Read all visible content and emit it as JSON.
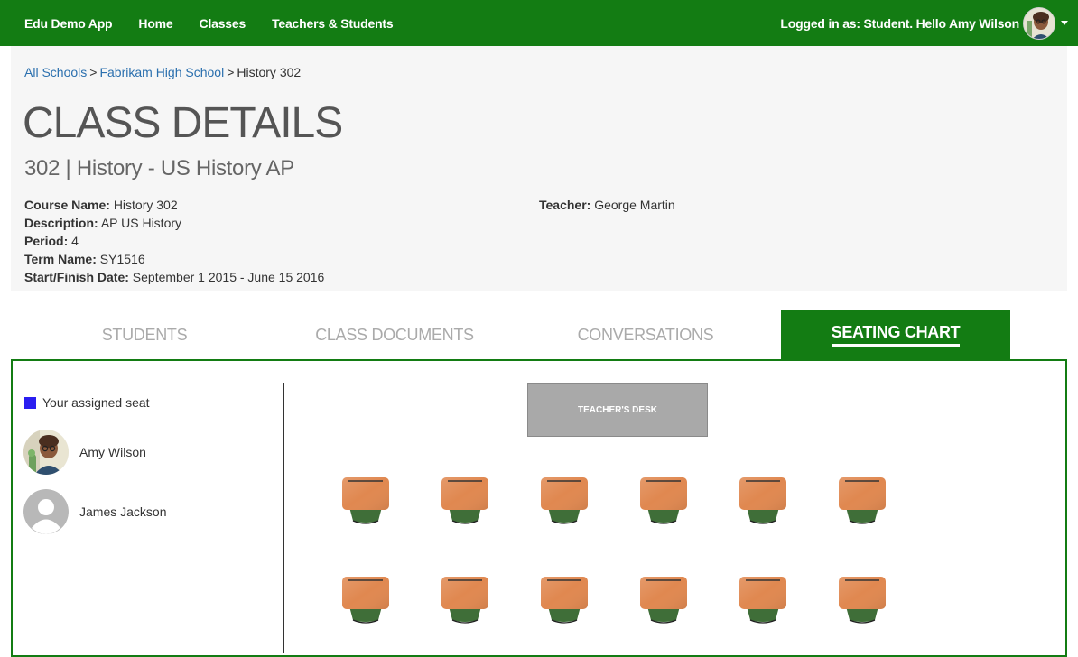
{
  "navbar": {
    "brand": "Edu Demo App",
    "links": [
      "Home",
      "Classes",
      "Teachers & Students"
    ],
    "login_text": "Logged in as: Student. Hello Amy Wilson"
  },
  "breadcrumb": {
    "items": [
      "All Schools",
      "Fabrikam High School"
    ],
    "current": "History 302",
    "separator": ">"
  },
  "page": {
    "title": "CLASS DETAILS",
    "subtitle": "302 | History - US History AP"
  },
  "details": {
    "course_name_label": "Course Name:",
    "course_name": "History 302",
    "description_label": "Description:",
    "description": "AP US History",
    "period_label": "Period:",
    "period": "4",
    "term_label": "Term Name:",
    "term": "SY1516",
    "dates_label": "Start/Finish Date:",
    "dates": "September 1 2015 - June 15 2016",
    "teacher_label": "Teacher:",
    "teacher": "George Martin"
  },
  "tabs": [
    {
      "label": "STUDENTS",
      "active": false
    },
    {
      "label": "CLASS DOCUMENTS",
      "active": false
    },
    {
      "label": "CONVERSATIONS",
      "active": false
    },
    {
      "label": "SEATING CHART",
      "active": true
    }
  ],
  "seating": {
    "legend_label": "Your assigned seat",
    "legend_color": "#2a1ef0",
    "students": [
      {
        "name": "Amy Wilson",
        "avatar": "cartoon-avatar"
      },
      {
        "name": "James Jackson",
        "avatar": "default-user-icon"
      }
    ],
    "teacher_desk_label": "TEACHER'S DESK",
    "rows": 2,
    "cols": 6
  },
  "colors": {
    "brand_green": "#137c13",
    "desk_orange": "#e08850",
    "chair_green": "#3f6e38"
  }
}
